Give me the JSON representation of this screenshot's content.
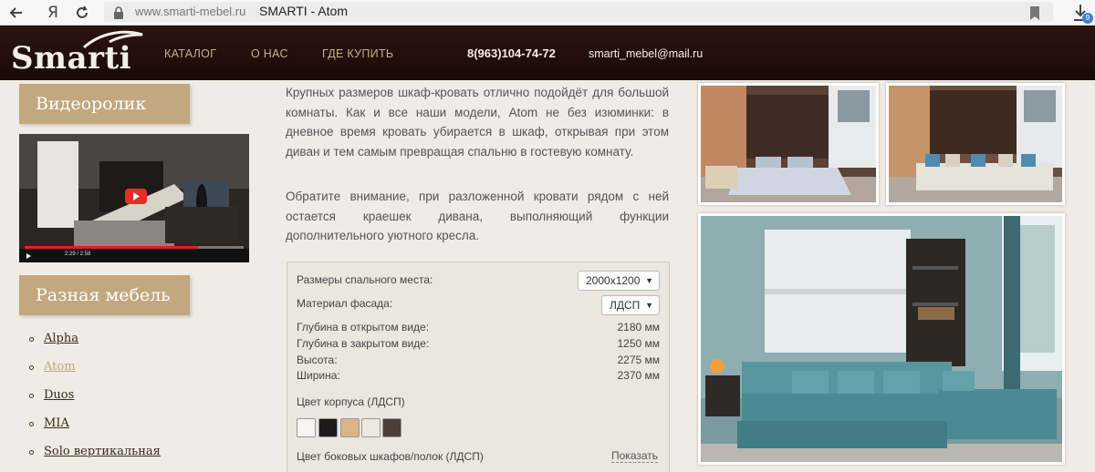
{
  "browser": {
    "back_icon": "back-arrow-icon",
    "yandex_icon": "yandex-icon",
    "yandex_glyph": "Я",
    "reload_icon": "reload-icon",
    "url": "www.smarti-mebel.ru",
    "title": "SMARTI - Atom",
    "download_count": "9"
  },
  "header": {
    "logo_text": "Smarti",
    "nav": [
      "КАТАЛОГ",
      "О НАС",
      "ГДЕ КУПИТЬ"
    ],
    "phone": "8(963)104-74-72",
    "email": "smarti_mebel@mail.ru"
  },
  "sidebar": {
    "video_heading": "Видеоролик",
    "video_time": "2:29 / 2:58",
    "furniture_heading": "Разная мебель",
    "items": [
      {
        "label": "Alpha",
        "active": false
      },
      {
        "label": "Atom",
        "active": true
      },
      {
        "label": "Duos",
        "active": false
      },
      {
        "label": "MIA",
        "active": false
      },
      {
        "label": "Solo вертикальная",
        "active": false
      }
    ]
  },
  "description": {
    "p1": "Крупных размеров шкаф-кровать отлично подойдёт для большой комнаты. Как и все наши модели, Atom не без изюминки: в дневное время кровать убирается в шкаф, открывая при этом диван и тем самым превращая спальню в гостевую комнату.",
    "p2": "Обратите внимание, при разложенной кровати рядом с ней остается краешек дивана, выполняющий функции дополнительного уютного кресла."
  },
  "specs": {
    "sleep_size_label": "Размеры спального места:",
    "sleep_size_value": "2000x1200",
    "facade_label": "Материал фасада:",
    "facade_value": "ЛДСП",
    "rows": [
      {
        "label": "Глубина в открытом виде:",
        "value": "2180 мм"
      },
      {
        "label": "Глубина в закрытом виде:",
        "value": "1250 мм"
      },
      {
        "label": "Высота:",
        "value": "2275 мм"
      },
      {
        "label": "Ширина:",
        "value": "2370 мм"
      }
    ],
    "body_color_label": "Цвет корпуса (ЛДСП)",
    "swatches": [
      "#f7f5f0",
      "#1e1a18",
      "#d9b48a",
      "#efe8dc",
      "#4a4038"
    ],
    "side_color_label": "Цвет боковых шкафов/полок (ЛДСП)",
    "show_link": "Показать"
  },
  "colors": {
    "header_bg": "#1a0b08",
    "accent": "#c2a77f",
    "page_bg": "#f0ebe4"
  }
}
